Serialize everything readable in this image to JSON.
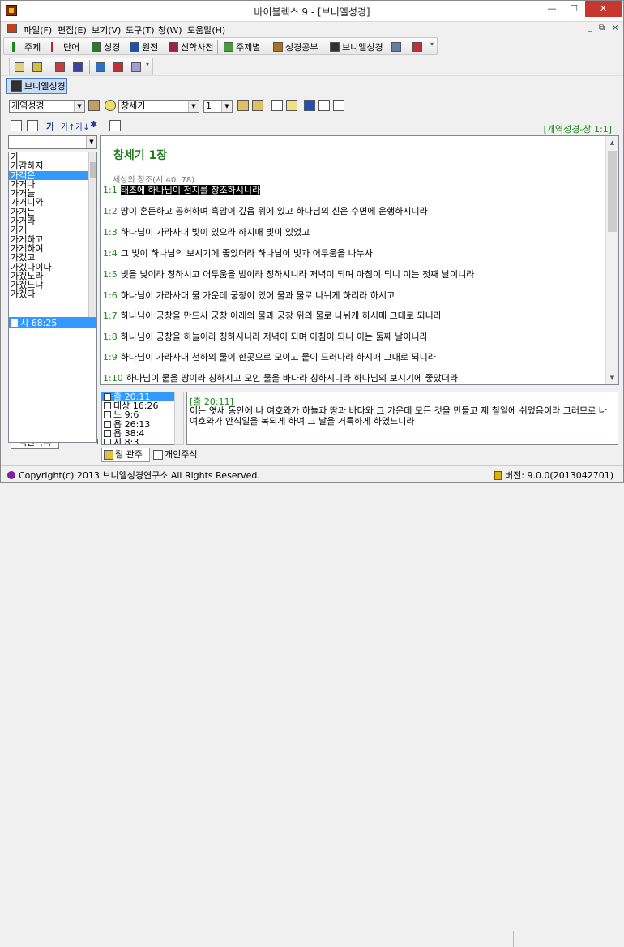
{
  "window": {
    "title": "바이블렉스 9 - [브니엘성경]",
    "min": "—",
    "max": "☐",
    "close": "✕"
  },
  "menu": {
    "items": [
      "파일(F)",
      "편집(E)",
      "보기(V)",
      "도구(T)",
      "창(W)",
      "도움말(H)"
    ],
    "mdi": [
      "_",
      "⧉",
      "×"
    ]
  },
  "toolbar1": {
    "items": [
      "주제",
      "단어",
      "성경",
      "원전",
      "신학사전",
      "주제별",
      "성경공부",
      "브니엘성경"
    ]
  },
  "doc_tab": {
    "label": "브니엘성경"
  },
  "controls": {
    "version": "개역성경",
    "book": "창세기",
    "chapter": "1"
  },
  "reference": "[개역성경-창 1:1]",
  "word_list": {
    "search_value": "",
    "items": [
      "가",
      "가감하지",
      "가객은",
      "가거나",
      "가거늘",
      "가거니와",
      "가거든",
      "가거라",
      "가게",
      "가게하고",
      "가게하여",
      "가겠고",
      "가겠나이다",
      "가겠노라",
      "가겠느냐",
      "가겠다"
    ],
    "selected_index": 2
  },
  "index": {
    "button": "색인목록",
    "count": "1",
    "items": [
      "시 68:25"
    ]
  },
  "bible": {
    "chapter_title": "창세기 1장",
    "section": "세상의 창조(시 40, 78)",
    "verses": [
      {
        "num": "1:1",
        "text": "태초에 하나님이 천지를 창조하시니라",
        "highlight": true
      },
      {
        "num": "1:2",
        "text": "땅이 혼돈하고 공허하며 흑암이 깊음 위에 있고 하나님의 신은 수면에 운행하시니라"
      },
      {
        "num": "1:3",
        "text": "하나님이 가라사대 빛이 있으라 하시매 빛이 있었고"
      },
      {
        "num": "1:4",
        "text": "그 빛이 하나님의 보시기에 좋았더라 하나님이 빛과 어두움을 나누사"
      },
      {
        "num": "1:5",
        "text": "빛을 낮이라 칭하시고 어두움을 밤이라 칭하시니라 저녁이 되며 아침이 되니 이는 첫째 날이니라"
      },
      {
        "num": "1:6",
        "text": "하나님이 가라사대 물 가운데 궁창이 있어 물과 물로 나뉘게 하리라 하시고"
      },
      {
        "num": "1:7",
        "text": "하나님이 궁창을 만드사 궁창 아래의 물과 궁창 위의 물로 나뉘게 하시매 그대로 되니라"
      },
      {
        "num": "1:8",
        "text": "하나님이 궁창을 하늘이라 칭하시니라 저녁이 되며 아침이 되니 이는 둘째 날이니라"
      },
      {
        "num": "1:9",
        "text": "하나님이 가라사대 천하의 물이 한곳으로 모이고 뭍이 드러나라 하시매 그대로 되니라"
      },
      {
        "num": "1:10",
        "text": "하나님이 뭍을 땅이라 칭하시고 모인 물을 바다라 칭하시니라 하나님의 보시기에 좋았더라"
      }
    ]
  },
  "cross_refs": {
    "items": [
      "출 20:11",
      "대상 16:26",
      "느 9:6",
      "욥 26:13",
      "욥 38:4",
      "시 8:3"
    ],
    "selected_index": 0,
    "detail_ref": "[출 20:11]",
    "detail_text": "이는 엿새 동안에 나 여호와가 하늘과 땅과 바다와 그 가운데 모든 것을 만들고 제 칠일에 쉬었음이라 그러므로 나 여호와가 안식일을 복되게 하여 그 날을 거룩하게 하였느니라"
  },
  "bottom_tabs": [
    "절 관주",
    "개인주석"
  ],
  "status": {
    "left": "Copyright(c) 2013 브니엘성경연구소  All Rights Reserved.",
    "right": "버전: 9.0.0(2013042701)"
  },
  "colors": {
    "accent_green": "#1a8a1a",
    "selection": "#3399ff"
  }
}
